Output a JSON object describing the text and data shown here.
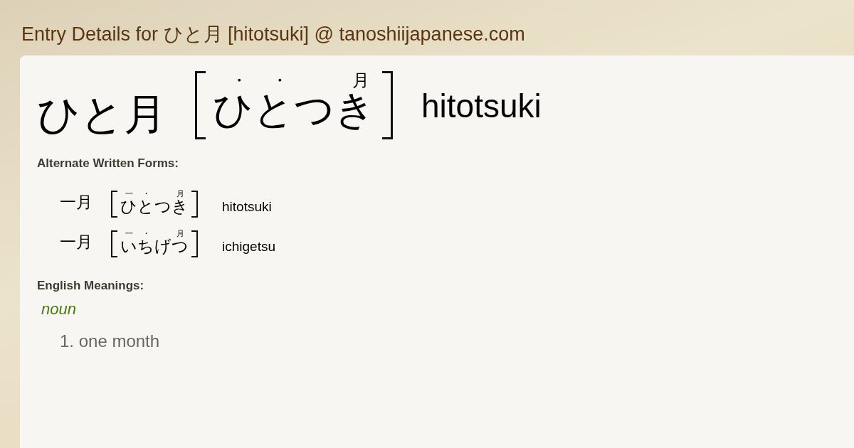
{
  "header": {
    "title": "Entry Details for ひと月 [hitotsuki] @ tanoshiijapanese.com"
  },
  "entry": {
    "word": "ひと月",
    "reading": [
      {
        "kana": "ひ",
        "mark": "・"
      },
      {
        "kana": "と",
        "mark": "・"
      },
      {
        "kana": "つき",
        "mark": "月"
      }
    ],
    "romaji": "hitotsuki"
  },
  "alternate_forms": {
    "heading": "Alternate Written Forms:",
    "items": [
      {
        "word": "一月",
        "reading": [
          {
            "kana": "ひ",
            "mark": "一"
          },
          {
            "kana": "と",
            "mark": "・"
          },
          {
            "kana": "つき",
            "mark": "月"
          }
        ],
        "romaji": "hitotsuki"
      },
      {
        "word": "一月",
        "reading": [
          {
            "kana": "い",
            "mark": "一"
          },
          {
            "kana": "ち",
            "mark": "・"
          },
          {
            "kana": "げつ",
            "mark": "月"
          }
        ],
        "romaji": "ichigetsu"
      }
    ]
  },
  "meanings": {
    "heading": "English Meanings:",
    "groups": [
      {
        "pos": "noun",
        "senses": [
          "1. one month"
        ]
      }
    ]
  }
}
